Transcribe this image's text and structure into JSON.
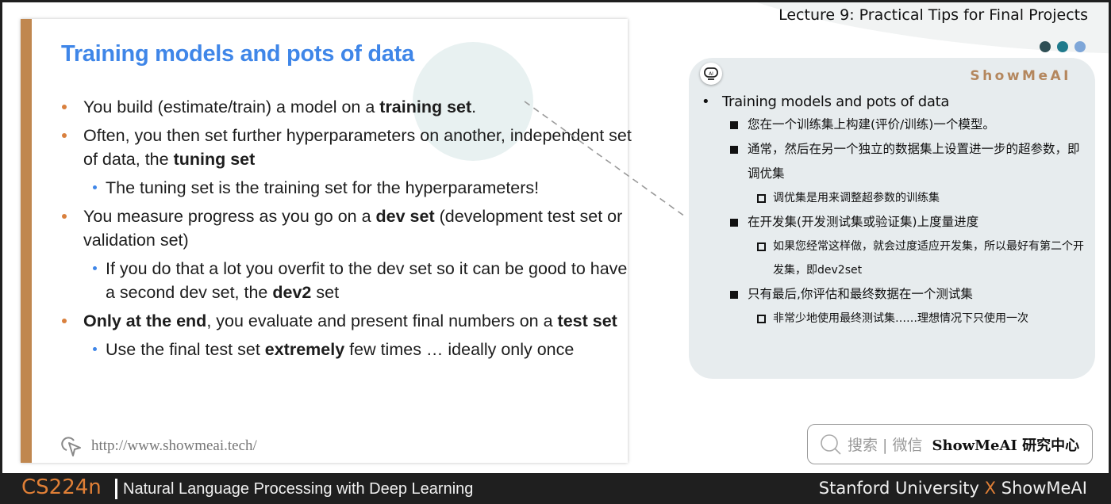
{
  "header": {
    "lecture_title": "Lecture 9: Practical Tips for Final Projects",
    "dot_colors": [
      "#2f4f55",
      "#1f7a8c",
      "#7ea6d8"
    ]
  },
  "slide": {
    "title": "Training models and pots of data",
    "accent_color": "#c0874f",
    "title_color": "#3f86e8",
    "items": [
      {
        "level": 1,
        "parts": [
          {
            "t": "You build (estimate/train) a model on a "
          },
          {
            "t": "training set",
            "b": true
          },
          {
            "t": "."
          }
        ]
      },
      {
        "level": 1,
        "parts": [
          {
            "t": "Often, you then set further hyperparameters on another, independent set of data, the "
          },
          {
            "t": "tuning set",
            "b": true
          }
        ]
      },
      {
        "level": 2,
        "parts": [
          {
            "t": "The tuning set is the training set for the hyperparameters!"
          }
        ]
      },
      {
        "level": 1,
        "parts": [
          {
            "t": "You measure progress as you go on a "
          },
          {
            "t": "dev set",
            "b": true
          },
          {
            "t": " (development test set or validation set)"
          }
        ]
      },
      {
        "level": 2,
        "parts": [
          {
            "t": "If you do that a lot you overfit to the dev set so it can be good to have a second dev set, the "
          },
          {
            "t": "dev2",
            "b": true
          },
          {
            "t": " set"
          }
        ]
      },
      {
        "level": 1,
        "parts": [
          {
            "t": "Only at the end",
            "b": true
          },
          {
            "t": ", you evaluate and present final numbers on a "
          },
          {
            "t": "test set",
            "b": true
          }
        ]
      },
      {
        "level": 2,
        "parts": [
          {
            "t": "Use the final test set "
          },
          {
            "t": "extremely",
            "b": true
          },
          {
            "t": " few times … ideally only once"
          }
        ]
      }
    ],
    "footer_url": "http://www.showmeai.tech/"
  },
  "panel": {
    "brand": "ShowMeAI",
    "robot_icon_text": "AI",
    "items": [
      {
        "level": 1,
        "text": "Training models and pots of data"
      },
      {
        "level": 2,
        "text": "您在一个训练集上构建(评价/训练)一个模型。"
      },
      {
        "level": 2,
        "text": "通常，然后在另一个独立的数据集上设置进一步的超参数，即调优集"
      },
      {
        "level": 3,
        "text": "调优集是用来调整超参数的训练集"
      },
      {
        "level": 2,
        "text": "在开发集(开发测试集或验证集)上度量进度"
      },
      {
        "level": 3,
        "text": "如果您经常这样做，就会过度适应开发集，所以最好有第二个开发集，即dev2set"
      },
      {
        "level": 2,
        "text": "只有最后,你评估和最终数据在一个测试集"
      },
      {
        "level": 3,
        "text": "非常少地使用最终测试集……理想情况下只使用一次"
      }
    ]
  },
  "search": {
    "hint": "搜索 | 微信",
    "brand": "ShowMeAI 研究中心"
  },
  "bottom": {
    "course_code": "CS224n",
    "course_name": "Natural Language Processing with Deep Learning",
    "partner_left": "Stanford University",
    "partner_x": "X",
    "partner_right": "ShowMeAI"
  }
}
